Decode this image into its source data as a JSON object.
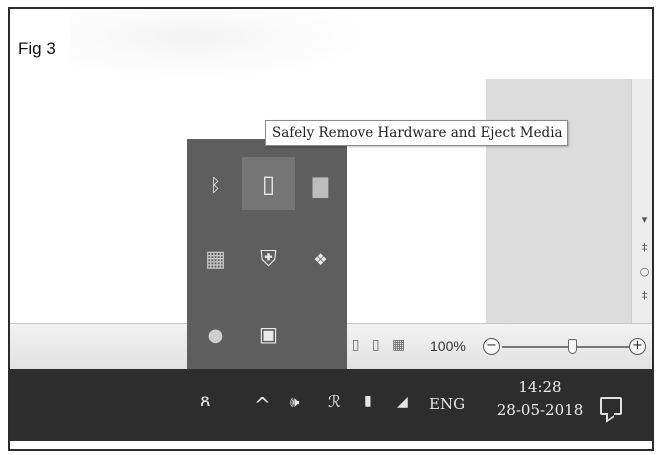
{
  "figure": {
    "label": "Fig 3"
  },
  "tooltip": {
    "text": "Safely Remove Hardware and Eject Media"
  },
  "flyout": {
    "icons": [
      {
        "name": "bluetooth-icon",
        "glyph": "ᛒ"
      },
      {
        "name": "usb-drive-icon",
        "glyph": "▯"
      },
      {
        "name": "notes-icon",
        "glyph": "▇"
      },
      {
        "name": "app-tile-icon",
        "glyph": "▦"
      },
      {
        "name": "windows-defender-icon",
        "glyph": "⛨"
      },
      {
        "name": "dropbox-icon",
        "glyph": "❖"
      },
      {
        "name": "satellite-icon",
        "glyph": "●"
      },
      {
        "name": "document-app-icon",
        "glyph": "▣"
      }
    ]
  },
  "statusbar": {
    "zoom_level": "100%",
    "zoom_out": "−",
    "zoom_in": "+",
    "zoom_slider_fraction": 0.55
  },
  "scrollbar": {
    "glyphs": [
      "▾",
      "‡",
      "○",
      "‡"
    ]
  },
  "taskbar": {
    "people_icon": "ጸ",
    "show_hidden_icon": "^",
    "volume_icon": "🕪",
    "sync_icon": "ℛ",
    "battery_icon": "▮",
    "wifi_icon": "◢",
    "language": "ENG",
    "time": "14:28",
    "date": "28-05-2018"
  },
  "colors": {
    "taskbar": "#2d2d2d",
    "flyout": "#5e5e5e",
    "flyout_hot": "#757575"
  }
}
